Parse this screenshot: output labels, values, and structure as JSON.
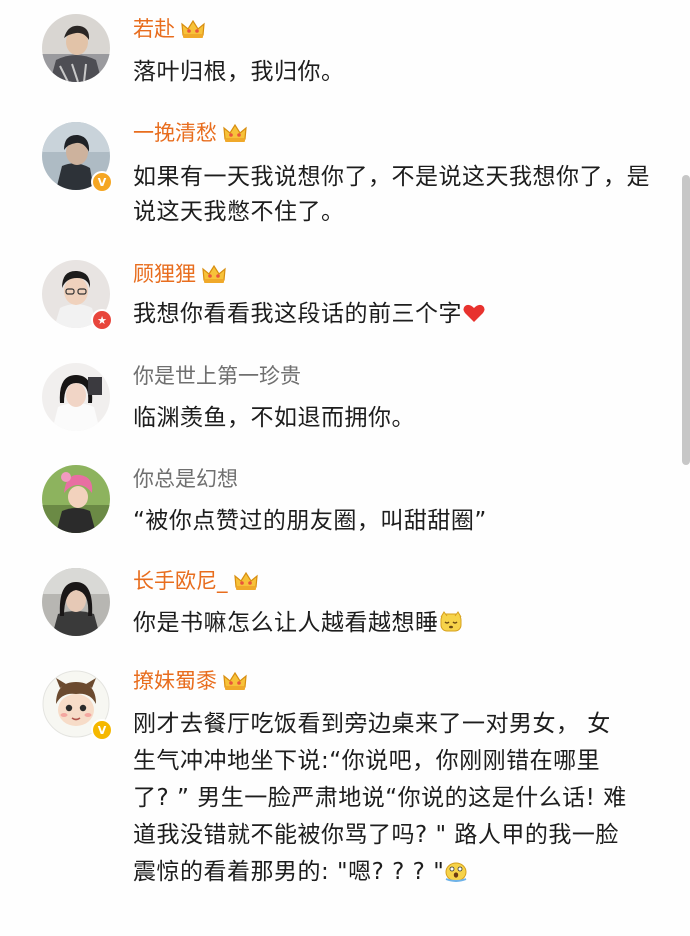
{
  "comments": [
    {
      "username": "若赴",
      "text": "落叶归根，我归你。",
      "vip": true,
      "badge": ""
    },
    {
      "username": "一挽清愁",
      "text": "如果有一天我说想你了，不是说这天我想你了，是说这天我憋不住了。",
      "vip": true,
      "badge": "orange-v"
    },
    {
      "username": "顾狸狸",
      "text": "我想你看看我这段话的前三个字",
      "vip": true,
      "badge": "red-star",
      "trailing_icon": "heart-icon"
    },
    {
      "username": "你是世上第一珍贵",
      "text": "临渊羡鱼，不如退而拥你。",
      "vip": false,
      "badge": ""
    },
    {
      "username": "你总是幻想",
      "text": "“被你点赞过的朋友圈，叫甜甜圈”",
      "vip": false,
      "badge": ""
    },
    {
      "username": "长手欧尼_",
      "text": "你是书嘛怎么让人越看越想睡",
      "vip": true,
      "badge": "",
      "trailing_icon": "sleepy-face-icon"
    },
    {
      "username": "撩妹蜀黍",
      "text": "刚才去餐厅吃饭看到旁边桌来了一对男女， 女生气冲冲地坐下说:“你说吧，你刚刚错在哪里了? ” 男生一脸严肃地说“你说的这是什么话! 难道我没错就不能被你骂了吗? \" 路人甲的我一脸震惊的看着那男的: \"嗯? ? ? \"",
      "vip": true,
      "badge": "yellow-v",
      "trailing_icon": "shocked-face-icon"
    }
  ],
  "colors": {
    "vip_name": "#e86d1e",
    "plain_name": "#6f6f6f",
    "text": "#1d1d1d",
    "orange_v": "#f5a623",
    "red_star": "#e8463c",
    "yellow_v": "#f5b800"
  }
}
